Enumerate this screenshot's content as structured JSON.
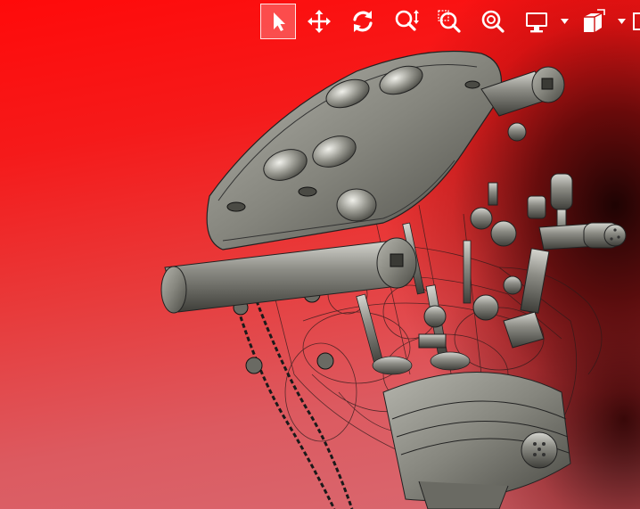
{
  "toolbar": {
    "tools": [
      {
        "id": "select",
        "icon": "select-arrow-icon",
        "active": true
      },
      {
        "id": "pan",
        "icon": "pan-move-icon",
        "active": false
      },
      {
        "id": "rotate",
        "icon": "rotate-orbit-icon",
        "active": false
      },
      {
        "id": "zoom-vertical",
        "icon": "zoom-drag-icon",
        "active": false
      },
      {
        "id": "zoom-window",
        "icon": "zoom-window-icon",
        "active": false
      },
      {
        "id": "zoom-fit",
        "icon": "zoom-fit-icon",
        "active": false
      },
      {
        "id": "display-mode",
        "icon": "monitor-display-icon",
        "dropdown": true
      },
      {
        "id": "view-orientation",
        "icon": "view-cube-icon",
        "dropdown": true
      }
    ],
    "icon_color": "#ffffff",
    "active_bg": "#ffffff40"
  },
  "viewport": {
    "background_top": "#ff0a0a",
    "background_bottom": "#d86a72",
    "model": "engine-assembly-3d-model",
    "model_color": "#8a8a82"
  }
}
